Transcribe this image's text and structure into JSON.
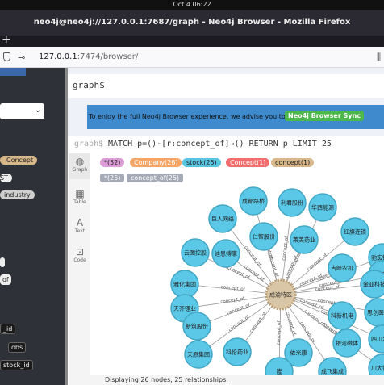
{
  "os": {
    "clock": "Oct 4  06:22"
  },
  "window": {
    "title": "neo4j@neo4j://127.0.0.1:7687/graph - Neo4j Browser - Mozilla Firefox"
  },
  "tabs": {
    "new_tab": "+"
  },
  "address": {
    "url_host": "127.0.0.1",
    "url_rest": ":7474/browser/"
  },
  "sidebar": {
    "labels": [
      "Concept",
      "ST",
      "industry"
    ],
    "properties": [
      "_id",
      "obs",
      "stock_id"
    ],
    "tags": [
      "st"
    ],
    "edge_marks": [
      "t",
      "of"
    ]
  },
  "editor": {
    "prompt": "graph$"
  },
  "banner": {
    "text": "To enjoy the full Neo4j Browser experience, we advise you to use",
    "button": "Neo4j Browser Sync"
  },
  "frame": {
    "prompt": "graph$",
    "query": "MATCH p=()-[r:concept_of]→() RETURN p LIMIT 25",
    "node_pills": [
      {
        "label": "*(52)",
        "color": "#da9bd6"
      },
      {
        "label": "Company(26)",
        "color": "#f7a565"
      },
      {
        "label": "stock(25)",
        "color": "#58c6e2"
      },
      {
        "label": "Concept(1)",
        "color": "#f26d6d"
      },
      {
        "label": "concept(1)",
        "color": "#d8b88a"
      }
    ],
    "rel_pills": [
      {
        "label": "*(25)",
        "color": "#a5abb6"
      },
      {
        "label": "concept_of(25)",
        "color": "#a5abb6"
      }
    ],
    "tools": [
      {
        "icon": "graph-icon",
        "label": "Graph"
      },
      {
        "icon": "table-icon",
        "label": "Table"
      },
      {
        "icon": "text-icon",
        "label": "Text"
      },
      {
        "icon": "code-icon",
        "label": "Code"
      }
    ],
    "status": "Displaying 26 nodes, 25 relationships."
  },
  "graph": {
    "center": "成渝特区",
    "rel_label": "concept_of",
    "nodes": [
      "成都路桥",
      "利君股份",
      "华西能源",
      "巨人网络",
      "仁智股份",
      "莱美药业",
      "红旗连锁",
      "驰宏锌锗",
      "云图控股",
      "迪思搏康",
      "吉峰农机",
      "三钢",
      "金亚科技",
      "雅化集团",
      "天齐锂业",
      "科新机电",
      "思创医惠",
      "新筑股份",
      "天原集团",
      "科伦药业",
      "依米康",
      "银河磁体",
      "四川发展",
      "川大智胜",
      "成飞集成",
      "隆"
    ],
    "colors": {
      "node": "#5bc8e8",
      "node_stroke": "#43a6c4",
      "center": "#d9c6a6",
      "center_stroke": "#b89c74",
      "edge": "#999999"
    }
  }
}
